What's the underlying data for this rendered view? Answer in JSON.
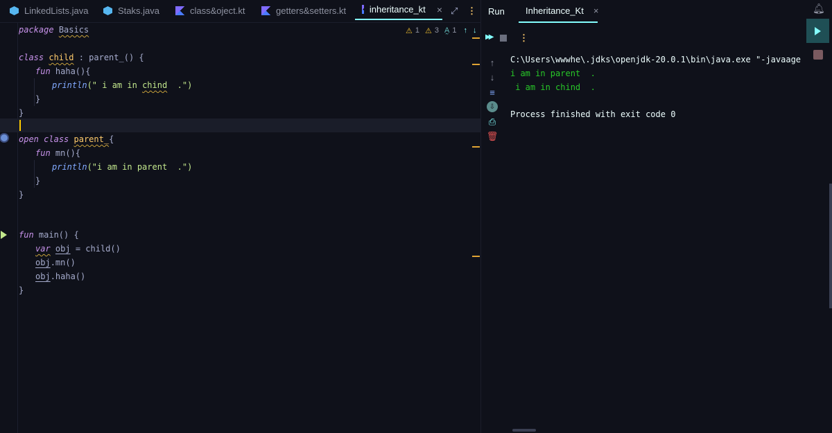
{
  "tabs": [
    {
      "label": "LinkedLists.java",
      "icon": "java-class-icon"
    },
    {
      "label": "Staks.java",
      "icon": "java-class-icon"
    },
    {
      "label": "class&oject.kt",
      "icon": "kotlin-icon"
    },
    {
      "label": "getters&setters.kt",
      "icon": "kotlin-icon"
    },
    {
      "label": "inheritance_kt",
      "icon": "kotlin-icon",
      "active": true
    }
  ],
  "editor": {
    "inspections": {
      "warnings": "1",
      "weak_warnings": "3",
      "typos": "1"
    },
    "lines": {
      "l1a": "package",
      "l1b": "Basics",
      "l3a": "class",
      "l3b": "child",
      "l3c": " : parent_() {",
      "l4a": "fun",
      "l4b": " haha(){",
      "l5a": "println",
      "l5b": "(\" i am in ",
      "l5c": "chind",
      "l5d": "  .\")",
      "l6": "}",
      "l7": "}",
      "l9a": "open",
      "l9b": "class",
      "l9c": "parent_",
      "l9d": "{",
      "l10a": "fun",
      "l10b": " mn(){",
      "l11a": "println",
      "l11b": "(\"i am in parent  .\")",
      "l12": "}",
      "l13": "}",
      "l16a": "fun",
      "l16b": " main() {",
      "l17a": "var",
      "l17b": "obj",
      "l17c": " = child()",
      "l18a": "obj",
      "l18b": ".mn()",
      "l19a": "obj",
      "l19b": ".haha()",
      "l20": "}"
    }
  },
  "run_panel": {
    "title": "Run",
    "tab_label": "Inheritance_Kt",
    "console": [
      "C:\\Users\\wwwhe\\.jdks\\openjdk-20.0.1\\bin\\java.exe \"-javaagent:C:\\Program",
      "i am in parent  .",
      " i am in chind  .",
      "",
      "Process finished with exit code 0"
    ]
  },
  "colors": {
    "accent": "#84ffff",
    "output": "#28c828",
    "warning": "#e0a434",
    "stop": "#e05252"
  }
}
